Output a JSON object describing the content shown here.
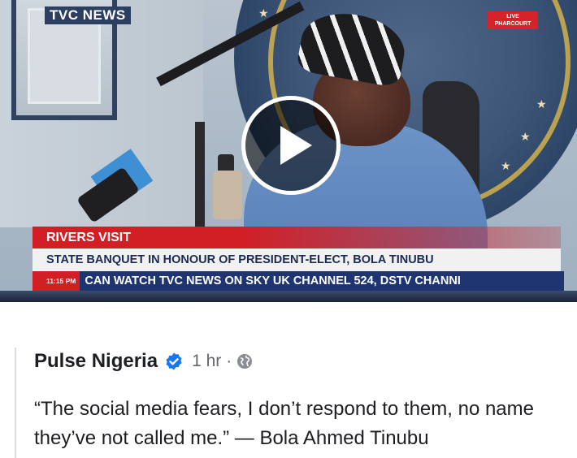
{
  "video": {
    "channel_logo": "TVC NEWS",
    "live_badge": "LIVE PHARCOURT",
    "lower_third_title": "RIVERS VISIT",
    "lower_third_subtitle": "STATE BANQUET IN HONOUR OF PRESIDENT-ELECT, BOLA TINUBU",
    "ticker_time": "11:15 PM",
    "ticker_text": "CAN WATCH TVC NEWS ON SKY UK CHANNEL 524, DSTV CHANNI",
    "play_icon": "play-icon"
  },
  "post": {
    "page_name": "Pulse Nigeria",
    "verified_icon": "verified-badge-icon",
    "time": "1 hr",
    "separator": "·",
    "privacy_icon": "globe-icon",
    "caption": "“The social media fears, I don’t respond to them, no name they’ve not called me.” — Bola Ahmed Tinubu"
  },
  "colors": {
    "brand_red": "#d21f26",
    "ticker_blue": "#1f3572",
    "verified_blue": "#1877f2",
    "text_primary": "#1c1e21",
    "text_secondary": "#65676b"
  }
}
